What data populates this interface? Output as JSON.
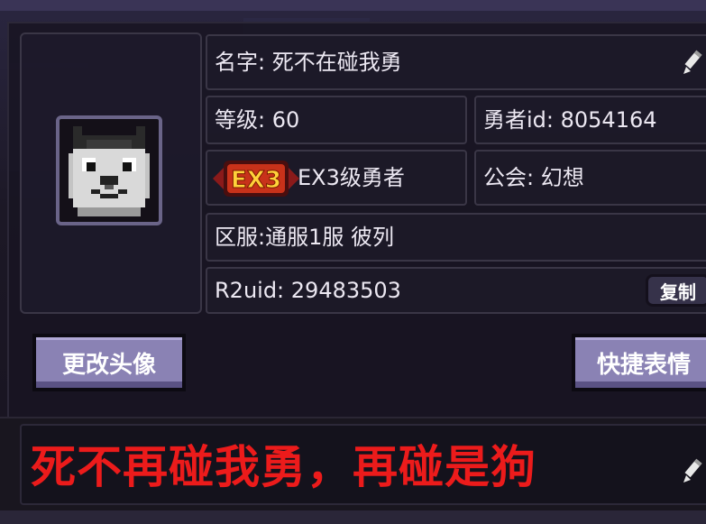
{
  "profile": {
    "name_label": "名字: 死不在碰我勇",
    "level_label": "等级: 60",
    "hero_id_label": "勇者id: 8054164",
    "rank_badge_text": "EX3",
    "rank_label": "EX3级勇者",
    "guild_label": "公会: 幻想",
    "server_label": "区服:通服1服 彼列",
    "uid_label": "R2uid: 29483503",
    "copy_label": "复制"
  },
  "buttons": {
    "change_avatar": "更改头像",
    "quick_emote": "快捷表情"
  },
  "motto": {
    "text": "死不再碰我勇，再碰是狗"
  },
  "icons": {
    "edit_name": "pencil-icon",
    "edit_motto": "pencil-icon",
    "avatar": "pixel-dog-avatar",
    "rank": "ex-rank-badge"
  },
  "colors": {
    "motto_text": "#ec1b1b",
    "button_fill": "#8a82b4",
    "panel_bg": "#1e1a2a"
  }
}
